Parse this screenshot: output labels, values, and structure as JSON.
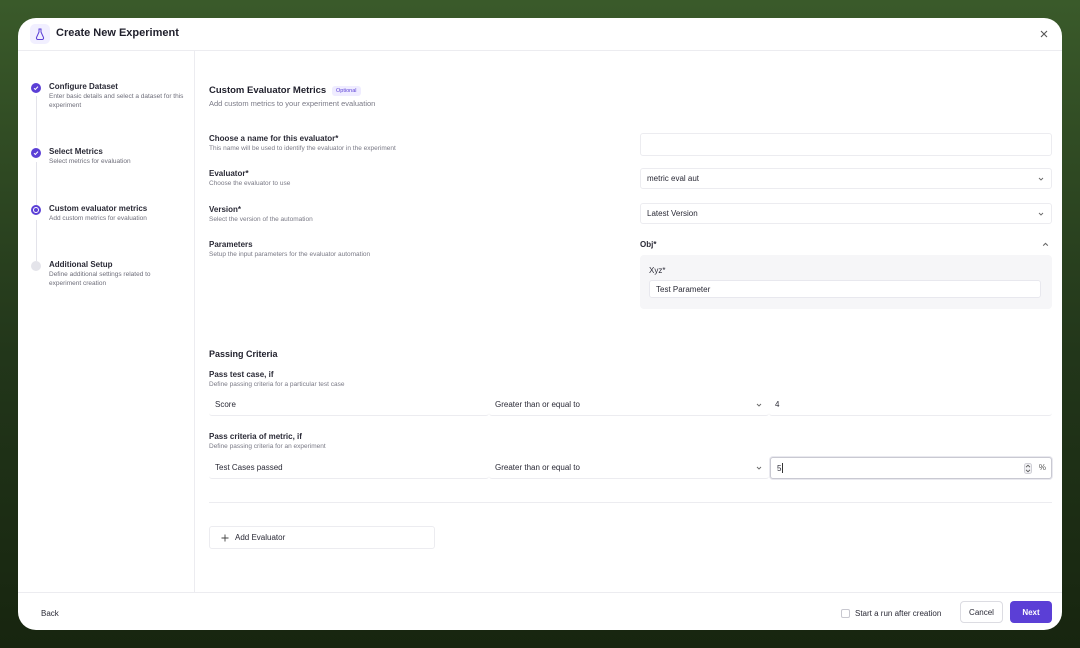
{
  "header": {
    "title": "Create New Experiment"
  },
  "sidebar": {
    "steps": [
      {
        "title": "Configure Dataset",
        "desc": "Enter basic details and select a dataset for this experiment",
        "state": "done"
      },
      {
        "title": "Select Metrics",
        "desc": "Select metrics for evaluation",
        "state": "done"
      },
      {
        "title": "Custom evaluator metrics",
        "desc": "Add custom metrics for evaluation",
        "state": "active"
      },
      {
        "title": "Additional Setup",
        "desc": "Define additional settings related to experiment creation",
        "state": "todo"
      }
    ]
  },
  "main": {
    "title": "Custom Evaluator Metrics",
    "badge": "Optional",
    "subtitle": "Add custom metrics to your experiment evaluation",
    "name_field": {
      "label": "Choose a name for this evaluator*",
      "hint": "This name will be used to identify the evaluator in the experiment",
      "value": ""
    },
    "evaluator": {
      "label": "Evaluator*",
      "hint": "Choose the evaluator to use",
      "value": "metric eval aut"
    },
    "version": {
      "label": "Version*",
      "hint": "Select the version of the automation",
      "value": "Latest Version"
    },
    "parameters": {
      "label": "Parameters",
      "hint": "Setup the input parameters for the evaluator automation",
      "group": "Obj*",
      "field_label": "Xyz*",
      "field_value": "Test Parameter"
    },
    "passing": {
      "title": "Passing Criteria",
      "test_case": {
        "label": "Pass test case, if",
        "hint": "Define passing criteria for a particular test case",
        "metric": "Score",
        "operator": "Greater than or equal to",
        "value": "4"
      },
      "metric": {
        "label": "Pass criteria of metric, if",
        "hint": "Define passing criteria for an experiment",
        "metric": "Test Cases passed",
        "operator": "Greater than or equal to",
        "value": "5",
        "unit": "%"
      }
    },
    "add_evaluator_label": "Add Evaluator"
  },
  "footer": {
    "back_label": "Back",
    "start_run_label": "Start a run after creation",
    "start_run_checked": false,
    "cancel_label": "Cancel",
    "next_label": "Next"
  },
  "colors": {
    "accent": "#5b3fd6",
    "badge_bg": "#efecff"
  }
}
